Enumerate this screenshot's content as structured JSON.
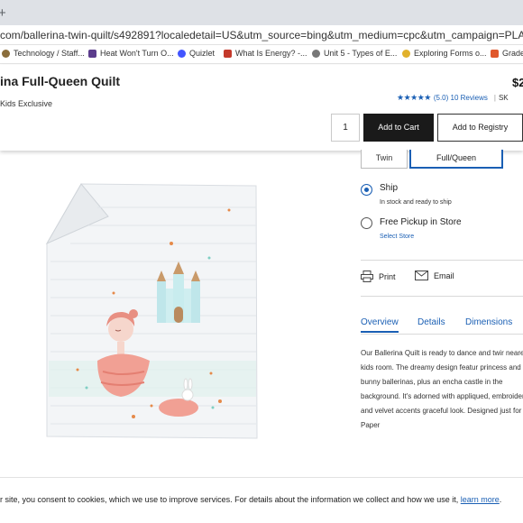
{
  "browser": {
    "new_tab_symbol": "+",
    "url_visible": "com/ballerina-twin-quilt/s492891?localedetail=US&utm_source=bing&utm_medium=cpc&utm_campaign=PLA&a=1869&scid=scbplp492891&s",
    "bookmarks": [
      {
        "label": "Technology / Staff...",
        "icon": "technology-icon",
        "color": "#8a6d3b"
      },
      {
        "label": "Heat Won't Turn O...",
        "icon": "heat-icon",
        "color": "#5b3c8c"
      },
      {
        "label": "Quizlet",
        "icon": "quizlet-icon",
        "color": "#4255ff"
      },
      {
        "label": "What Is Energy? -...",
        "icon": "energy-icon",
        "color": "#c4392b"
      },
      {
        "label": "Unit 5 - Types of E...",
        "icon": "unit5-icon",
        "color": "#777777"
      },
      {
        "label": "Exploring Forms o...",
        "icon": "exploring-icon",
        "color": "#e1b12c"
      },
      {
        "label": "Grade",
        "icon": "grade-icon",
        "color": "#e0572b"
      }
    ]
  },
  "product": {
    "title": "ina Full-Queen Quilt",
    "badge": "Kids Exclusive",
    "price": "$2",
    "stars": "★★★★★",
    "rating_text": "(5.0) 10 Reviews",
    "sep": "|",
    "sku_label": "SK",
    "quantity": "1",
    "add_to_cart": "Add to Cart",
    "add_to_registry": "Add to Registry",
    "sizes": [
      "Twin",
      "Full/Queen"
    ],
    "selected_size": "Full/Queen"
  },
  "fulfillment": {
    "ship_title": "Ship",
    "ship_sub": "In stock and ready to ship",
    "pickup_title": "Free Pickup in Store",
    "pickup_link": "Select Store"
  },
  "actions": {
    "print": "Print",
    "email": "Email"
  },
  "tabs": [
    "Overview",
    "Details",
    "Dimensions"
  ],
  "description": "Our Ballerina Quilt is ready to dance and twir nearest kids room. The dreamy design featur princess and bunny ballerinas, plus an encha castle in the background. It's adorned with appliqued, embroidered and velvet accents graceful look. Designed just for us by Paper",
  "cookie": {
    "text": "r site, you consent to cookies, which we use to improve services. For details about the information we collect and how we use it, ",
    "link": "learn more",
    "end": "."
  },
  "colors": {
    "accent": "#1a5fb4",
    "button_dark": "#1a1a1a"
  }
}
